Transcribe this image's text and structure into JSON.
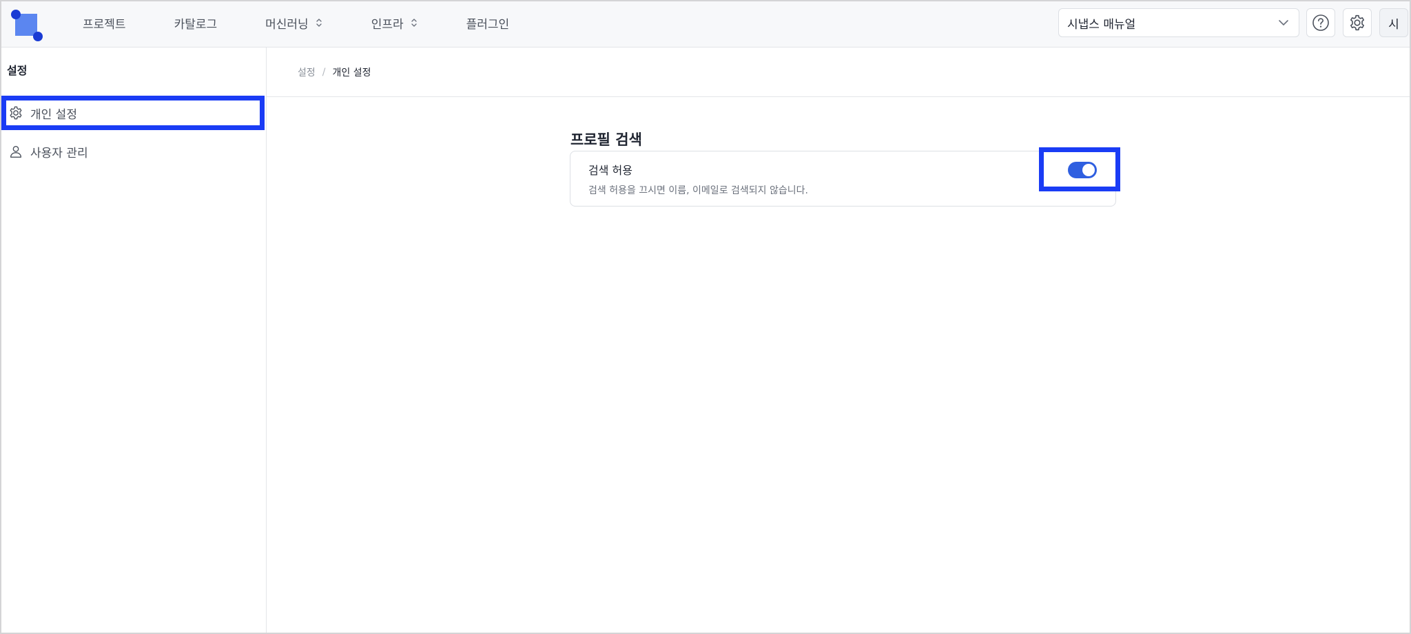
{
  "nav": {
    "items": [
      {
        "label": "프로젝트",
        "has_chevron": false
      },
      {
        "label": "카탈로그",
        "has_chevron": false
      },
      {
        "label": "머신러닝",
        "has_chevron": true
      },
      {
        "label": "인프라",
        "has_chevron": true
      },
      {
        "label": "플러그인",
        "has_chevron": false
      }
    ]
  },
  "header": {
    "workspace_label": "시냅스 매뉴얼",
    "avatar_text": "시"
  },
  "sidebar": {
    "title": "설정",
    "items": [
      {
        "label": "개인 설정",
        "icon": "gear-icon",
        "active": true
      },
      {
        "label": "사용자 관리",
        "icon": "user-icon",
        "active": false
      }
    ]
  },
  "breadcrumb": {
    "root": "설정",
    "separator": "/",
    "current": "개인 설정"
  },
  "main": {
    "section_title": "프로필 검색",
    "setting": {
      "title": "검색 허용",
      "description": "검색 허용을 끄시면 이름, 이메일로 검색되지 않습니다.",
      "enabled": true
    }
  },
  "colors": {
    "accent": "#2f5fe0",
    "highlight": "#1a3cf5",
    "logo_square": "#5b86f0",
    "logo_dot": "#1a3bd4"
  }
}
